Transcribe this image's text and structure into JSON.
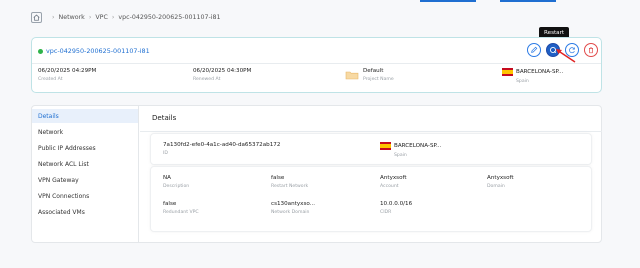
{
  "breadcrumb": {
    "items": [
      "Network",
      "VPC",
      "vpc-042950-200625-001107-i81"
    ]
  },
  "vpc": {
    "name": "vpc-042950-200625-001107-i81",
    "created": {
      "value": "06/20/2025 04:29PM",
      "label": "Created At"
    },
    "renewed": {
      "value": "06/20/2025 04:30PM",
      "label": "Renewed At"
    },
    "project": {
      "value": "Default",
      "label": "Project Name"
    },
    "region": {
      "value": "BARCELONA-SP...",
      "label": "Spain"
    }
  },
  "actions": {
    "tooltip": "Restart",
    "edit_icon": "pencil-icon",
    "restart_icon": "restart-icon",
    "refresh_icon": "refresh-icon",
    "delete_icon": "trash-icon"
  },
  "sidebar": {
    "items": [
      {
        "label": "Details"
      },
      {
        "label": "Network"
      },
      {
        "label": "Public IP Addresses"
      },
      {
        "label": "Network ACL List"
      },
      {
        "label": "VPN Gateway"
      },
      {
        "label": "VPN Connections"
      },
      {
        "label": "Associated VMs"
      }
    ]
  },
  "details": {
    "title": "Details",
    "id": {
      "value": "7a130fd2-efe0-4a1c-ad40-da65372ab172",
      "label": "ID"
    },
    "zone": {
      "value": "BARCELONA-SP...",
      "label": "Spain"
    },
    "description": {
      "value": "NA",
      "label": "Description"
    },
    "restart_network": {
      "value": "false",
      "label": "Restart Network"
    },
    "account": {
      "value": "Antyxsoft",
      "label": "Account"
    },
    "domain": {
      "value": "Antyxsoft",
      "label": "Domain"
    },
    "redundant_vpc": {
      "value": "false",
      "label": "Redundant VPC"
    },
    "network_domain": {
      "value": "cs130antyxso...",
      "label": "Network Domain"
    },
    "cidr": {
      "value": "10.0.0.0/16",
      "label": "CIDR"
    }
  },
  "colors": {
    "accent": "#1f6fd1",
    "status_green": "#2fb34a",
    "danger": "#e14a4a"
  }
}
